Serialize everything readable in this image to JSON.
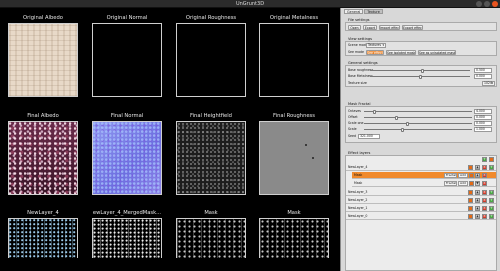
{
  "window": {
    "title": "UnGrunt3D"
  },
  "viewer": {
    "row1": [
      "Original Albedo",
      "Original Normal",
      "Original Roughness",
      "Original Metalness"
    ],
    "row2": [
      "Final Albedo",
      "Final Normal",
      "Final Heightfield",
      "Final Roughness"
    ],
    "row3": [
      "NewLayer_4",
      "ewLayer_4_MergedMask...",
      "Mask",
      "Mask"
    ]
  },
  "panel": {
    "tabs": [
      "General",
      "Texture"
    ],
    "file_settings": {
      "title": "File settings",
      "buttons": [
        "Open",
        "Export",
        "Import effect",
        "Export effect"
      ]
    },
    "view_settings": {
      "title": "View settings",
      "scene_mode_label": "Scene mode",
      "scene_mode_value": "Textures",
      "see_mode_label": "See mode",
      "see_mode_buttons": [
        "See effect",
        "See isolated mask",
        "See as unisolated mask"
      ]
    },
    "general_settings": {
      "title": "General settings",
      "rows": [
        {
          "label": "Base roughness",
          "value": "0.500",
          "level": 0.52
        },
        {
          "label": "Base Metalness",
          "value": "0.000",
          "level": 0.5
        }
      ],
      "texture_size_label": "Texture size",
      "texture_size_value": "1024"
    },
    "mask_fractal": {
      "title": "Mask Fractal",
      "rows": [
        {
          "label": "Octaves",
          "value": "4.000",
          "level": 0.1
        },
        {
          "label": "Offset",
          "value": "0.000",
          "level": 0.3
        },
        {
          "label": "Scale one",
          "value": "0.000",
          "level": 0.4
        },
        {
          "label": "Scale",
          "value": "1.000",
          "level": 0.36
        }
      ],
      "seed_label": "Seed",
      "seed_value": "321.000"
    },
    "effect_layers": {
      "title": "Effect layers",
      "rows": [
        {
          "name": "NewLayer_4",
          "kind": "layer"
        },
        {
          "name": "Mask",
          "kind": "mask",
          "selected": true,
          "blend": "Fractal",
          "op": "Add"
        },
        {
          "name": "Mask",
          "kind": "mask",
          "selected": false,
          "blend": "Fractal",
          "op": "Add"
        },
        {
          "name": "NewLayer_3",
          "kind": "layer"
        },
        {
          "name": "NewLayer_2",
          "kind": "layer"
        },
        {
          "name": "NewLayer_1",
          "kind": "layer"
        },
        {
          "name": "NewLayer_0",
          "kind": "layer"
        }
      ],
      "add_symbol": "+",
      "remove_symbol": "×",
      "up_symbol": "▲",
      "down_symbol": "▼"
    }
  },
  "colors": {
    "accent": "#e36a16",
    "add": "#4aa845",
    "panel_bg": "#d8d8d8"
  }
}
